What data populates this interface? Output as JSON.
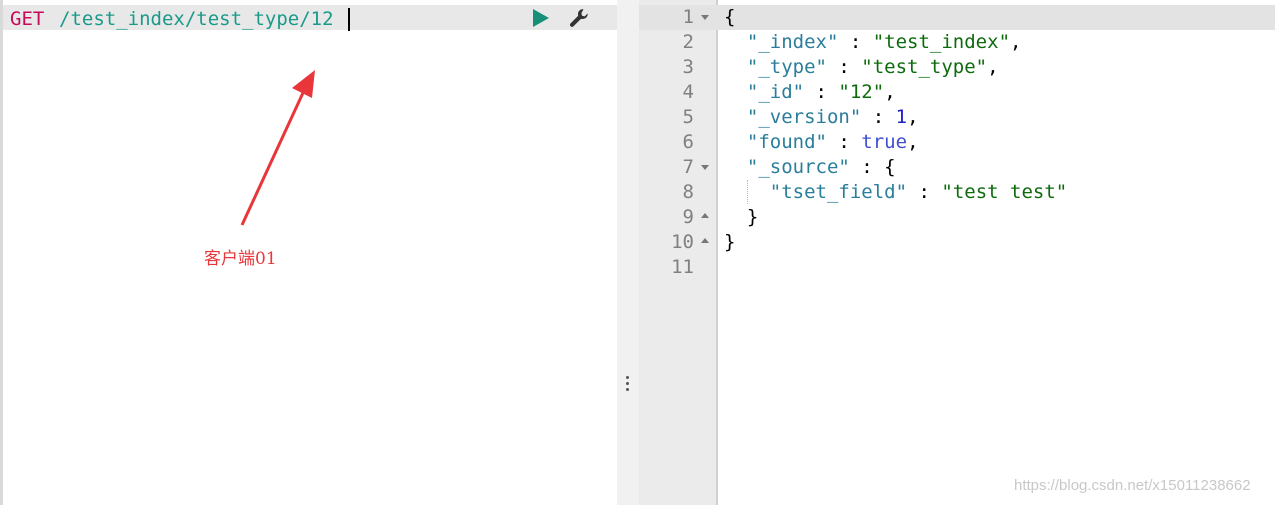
{
  "request": {
    "method": "GET",
    "path": "/test_index/test_type/12"
  },
  "toolbar": {
    "run_icon": "play-icon",
    "settings_icon": "wrench-icon",
    "run_color": "#17907a"
  },
  "response": {
    "line_numbers": [
      "1",
      "2",
      "3",
      "4",
      "5",
      "6",
      "7",
      "8",
      "9",
      "10",
      "11"
    ],
    "lines": [
      {
        "punc": "{"
      },
      {
        "key": "\"_index\"",
        "sep": " : ",
        "value": "\"test_index\"",
        "end": ","
      },
      {
        "key": "\"_type\"",
        "sep": " : ",
        "value": "\"test_type\"",
        "end": ","
      },
      {
        "key": "\"_id\"",
        "sep": " : ",
        "value": "\"12\"",
        "end": ","
      },
      {
        "key": "\"_version\"",
        "sep": " : ",
        "value": "1",
        "end": ","
      },
      {
        "key": "\"found\"",
        "sep": " : ",
        "value": "true",
        "end": ","
      },
      {
        "key": "\"_source\"",
        "sep": " : ",
        "value": "{"
      },
      {
        "key": "\"tset_field\"",
        "sep": " : ",
        "value": "\"test test\""
      },
      {
        "punc": "}"
      },
      {
        "punc": "}"
      },
      {
        "punc": ""
      }
    ]
  },
  "annotation": {
    "label": "客户端01",
    "color": "#e8363a"
  },
  "watermark": "https://blog.csdn.net/x15011238662"
}
